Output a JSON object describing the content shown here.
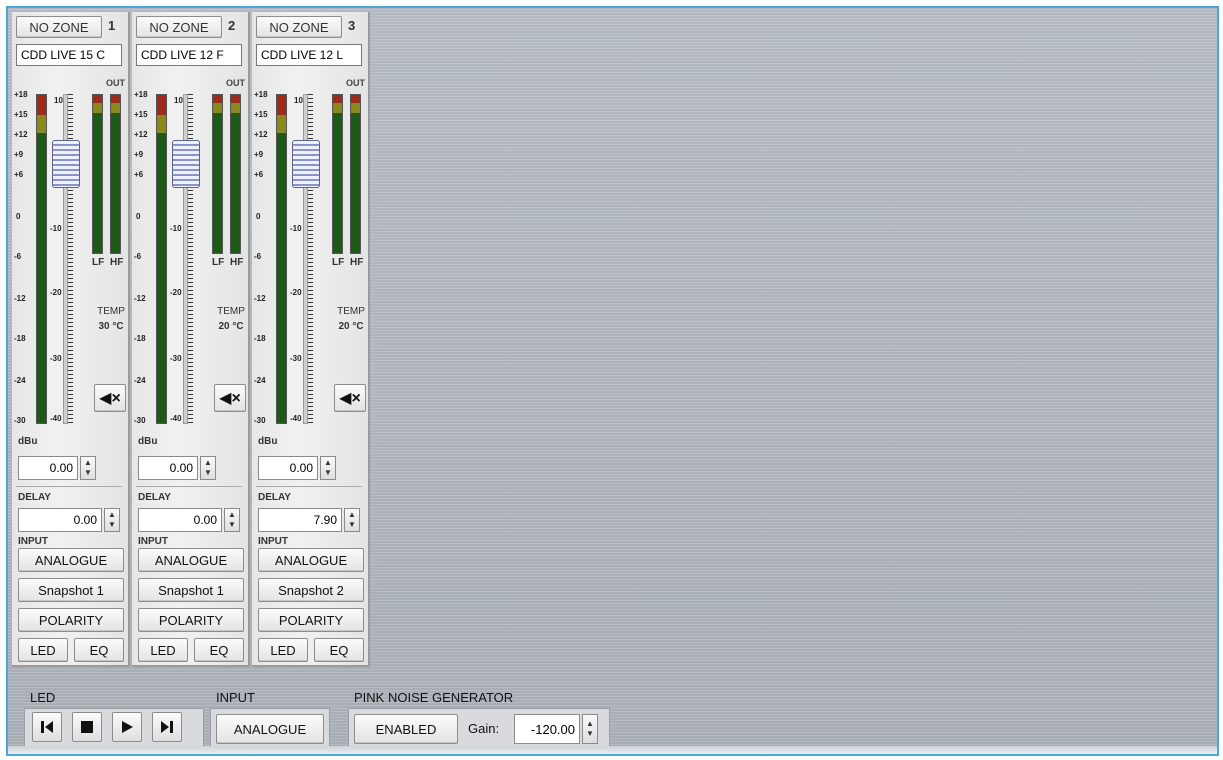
{
  "channels": [
    {
      "zone": "NO ZONE",
      "number": "1",
      "name": "CDD LIVE 15 C",
      "out_label": "OUT",
      "lf": "LF",
      "hf": "HF",
      "temp_label": "TEMP",
      "temp_value": "30 °C",
      "dbu_label": "dBu",
      "gain": "0.00",
      "delay_label": "DELAY",
      "delay": "0.00",
      "input_label": "INPUT",
      "input_button": "ANALOGUE",
      "snapshot_button": "Snapshot 1",
      "polarity_button": "POLARITY",
      "led_button": "LED",
      "eq_button": "EQ",
      "mute_icon": "mute-icon"
    },
    {
      "zone": "NO ZONE",
      "number": "2",
      "name": "CDD LIVE 12 F",
      "out_label": "OUT",
      "lf": "LF",
      "hf": "HF",
      "temp_label": "TEMP",
      "temp_value": "20 °C",
      "dbu_label": "dBu",
      "gain": "0.00",
      "delay_label": "DELAY",
      "delay": "0.00",
      "input_label": "INPUT",
      "input_button": "ANALOGUE",
      "snapshot_button": "Snapshot 1",
      "polarity_button": "POLARITY",
      "led_button": "LED",
      "eq_button": "EQ",
      "mute_icon": "mute-icon"
    },
    {
      "zone": "NO ZONE",
      "number": "3",
      "name": "CDD LIVE 12 L",
      "out_label": "OUT",
      "lf": "LF",
      "hf": "HF",
      "temp_label": "TEMP",
      "temp_value": "20 °C",
      "dbu_label": "dBu",
      "gain": "0.00",
      "delay_label": "DELAY",
      "delay": "7.90",
      "input_label": "INPUT",
      "input_button": "ANALOGUE",
      "snapshot_button": "Snapshot 2",
      "polarity_button": "POLARITY",
      "led_button": "LED",
      "eq_button": "EQ",
      "mute_icon": "mute-icon"
    }
  ],
  "meter_scale": [
    "+18",
    "+15",
    "+12",
    "+9",
    "+6",
    "0",
    "-6",
    "-12",
    "-18",
    "-24",
    "-30"
  ],
  "fader_scale": [
    "10",
    "-10",
    "-20",
    "-30",
    "-40"
  ],
  "bottom": {
    "led_label": "LED",
    "transport_icons": [
      "skip-back-icon",
      "stop-icon",
      "play-icon",
      "skip-forward-icon"
    ],
    "input_label": "INPUT",
    "input_button": "ANALOGUE",
    "pink_noise_label": "PINK NOISE GENERATOR",
    "pink_noise_button": "ENABLED",
    "gain_label": "Gain:",
    "gain_value": "-120.00"
  },
  "colors": {
    "meter_green": "#1d5a18",
    "meter_red": "#9c2b1e",
    "meter_yellow": "#8a8a1c",
    "frame_border": "#4aa8d8"
  }
}
